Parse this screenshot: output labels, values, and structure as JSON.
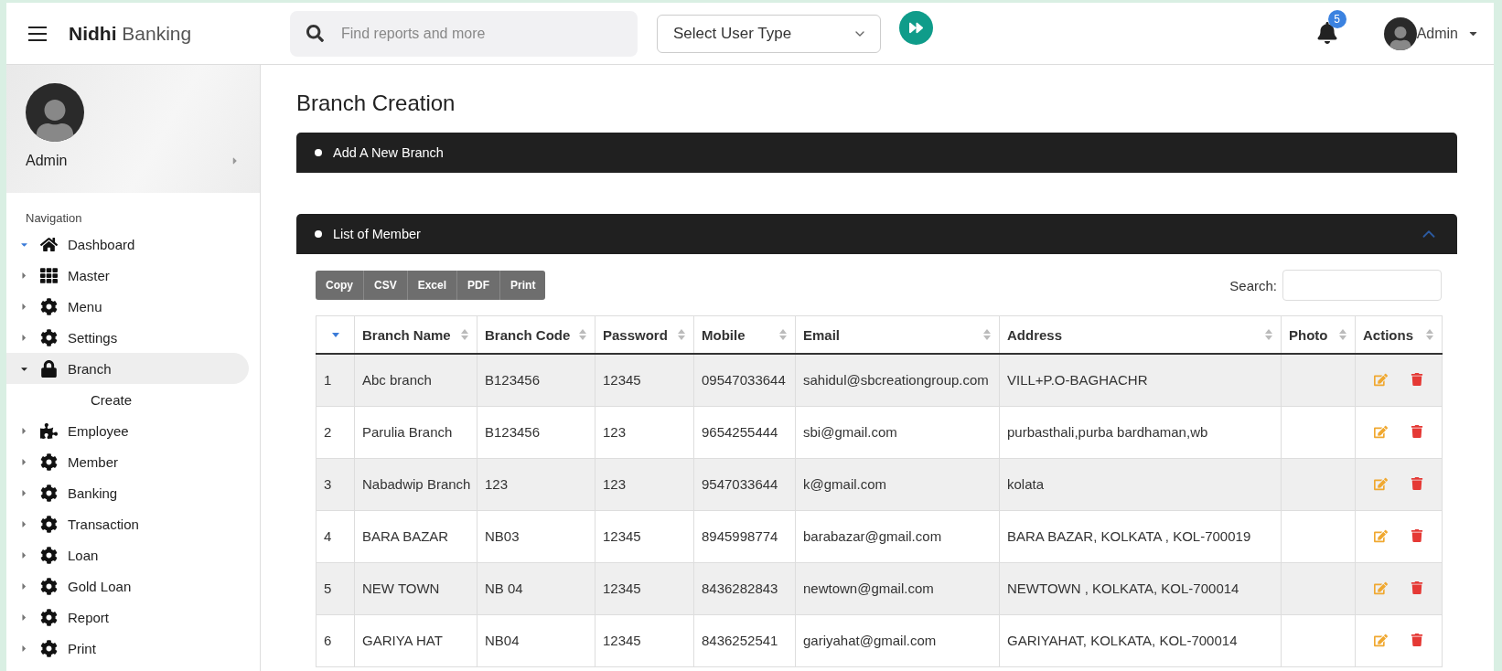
{
  "header": {
    "brand_bold": "Nidhi",
    "brand_light": "Banking",
    "search": {
      "placeholder": "Find reports and more"
    },
    "user_type": {
      "value": "Select User Type"
    },
    "notifications": "5",
    "user": "Admin"
  },
  "sidebar": {
    "profile": "Admin",
    "section": "Navigation",
    "items": [
      {
        "label": "Dashboard",
        "kind": "home",
        "expanded": true,
        "selected": false
      },
      {
        "label": "Master",
        "kind": "grid",
        "expanded": false,
        "selected": false
      },
      {
        "label": "Menu",
        "kind": "gear",
        "expanded": false,
        "selected": false
      },
      {
        "label": "Settings",
        "kind": "gear",
        "expanded": false,
        "selected": false
      },
      {
        "label": "Branch",
        "kind": "lock",
        "expanded": true,
        "selected": true,
        "children": [
          {
            "label": "Create"
          }
        ]
      },
      {
        "label": "Employee",
        "kind": "puzzle",
        "expanded": false,
        "selected": false
      },
      {
        "label": "Member",
        "kind": "gear",
        "expanded": false,
        "selected": false
      },
      {
        "label": "Banking",
        "kind": "gear",
        "expanded": false,
        "selected": false
      },
      {
        "label": "Transaction",
        "kind": "gear",
        "expanded": false,
        "selected": false
      },
      {
        "label": "Loan",
        "kind": "gear",
        "expanded": false,
        "selected": false
      },
      {
        "label": "Gold Loan",
        "kind": "gear",
        "expanded": false,
        "selected": false
      },
      {
        "label": "Report",
        "kind": "gear",
        "expanded": false,
        "selected": false
      },
      {
        "label": "Print",
        "kind": "gear",
        "expanded": false,
        "selected": false
      }
    ]
  },
  "page": {
    "title": "Branch Creation",
    "add_panel": {
      "title": "Add A New Branch"
    },
    "list_panel": {
      "title": "List of Member",
      "expanded": true,
      "export_buttons": [
        "Copy",
        "CSV",
        "Excel",
        "PDF",
        "Print"
      ],
      "search_label": "Search:",
      "table": {
        "columns": [
          {
            "sorted": true
          },
          {
            "label": "Branch Name",
            "sorted": false
          },
          {
            "label": "Branch Code",
            "sorted": false
          },
          {
            "label": "Password",
            "sorted": false
          },
          {
            "label": "Mobile",
            "sorted": false
          },
          {
            "label": "Email",
            "sorted": false
          },
          {
            "label": "Address",
            "sorted": false
          },
          {
            "label": "Photo",
            "sorted": false
          },
          {
            "label": "Actions",
            "sorted": false
          }
        ],
        "rows": [
          [
            "1",
            "Abc branch",
            "B123456",
            "12345",
            "09547033644",
            "sahidul@sbcreationgroup.com",
            "VILL+P.O-BAGHACHR"
          ],
          [
            "2",
            "Parulia Branch",
            "B123456",
            "123",
            "9654255444",
            "sbi@gmail.com",
            "purbasthali,purba bardhaman,wb"
          ],
          [
            "3",
            "Nabadwip Branch",
            "123",
            "123",
            "9547033644",
            "k@gmail.com",
            "kolata"
          ],
          [
            "4",
            "BARA BAZAR",
            "NB03",
            "12345",
            "8945998774",
            "barabazar@gmail.com",
            "BARA BAZAR, KOLKATA , KOL-700019"
          ],
          [
            "5",
            "NEW TOWN",
            "NB 04",
            "12345",
            "8436282843",
            "newtown@gmail.com",
            "NEWTOWN , KOLKATA, KOL-700014"
          ],
          [
            "6",
            "GARIYA HAT",
            "NB04",
            "12345",
            "8436252541",
            "gariyahat@gmail.com",
            "GARIYAHAT, KOLKATA, KOL-700014"
          ]
        ]
      }
    }
  }
}
